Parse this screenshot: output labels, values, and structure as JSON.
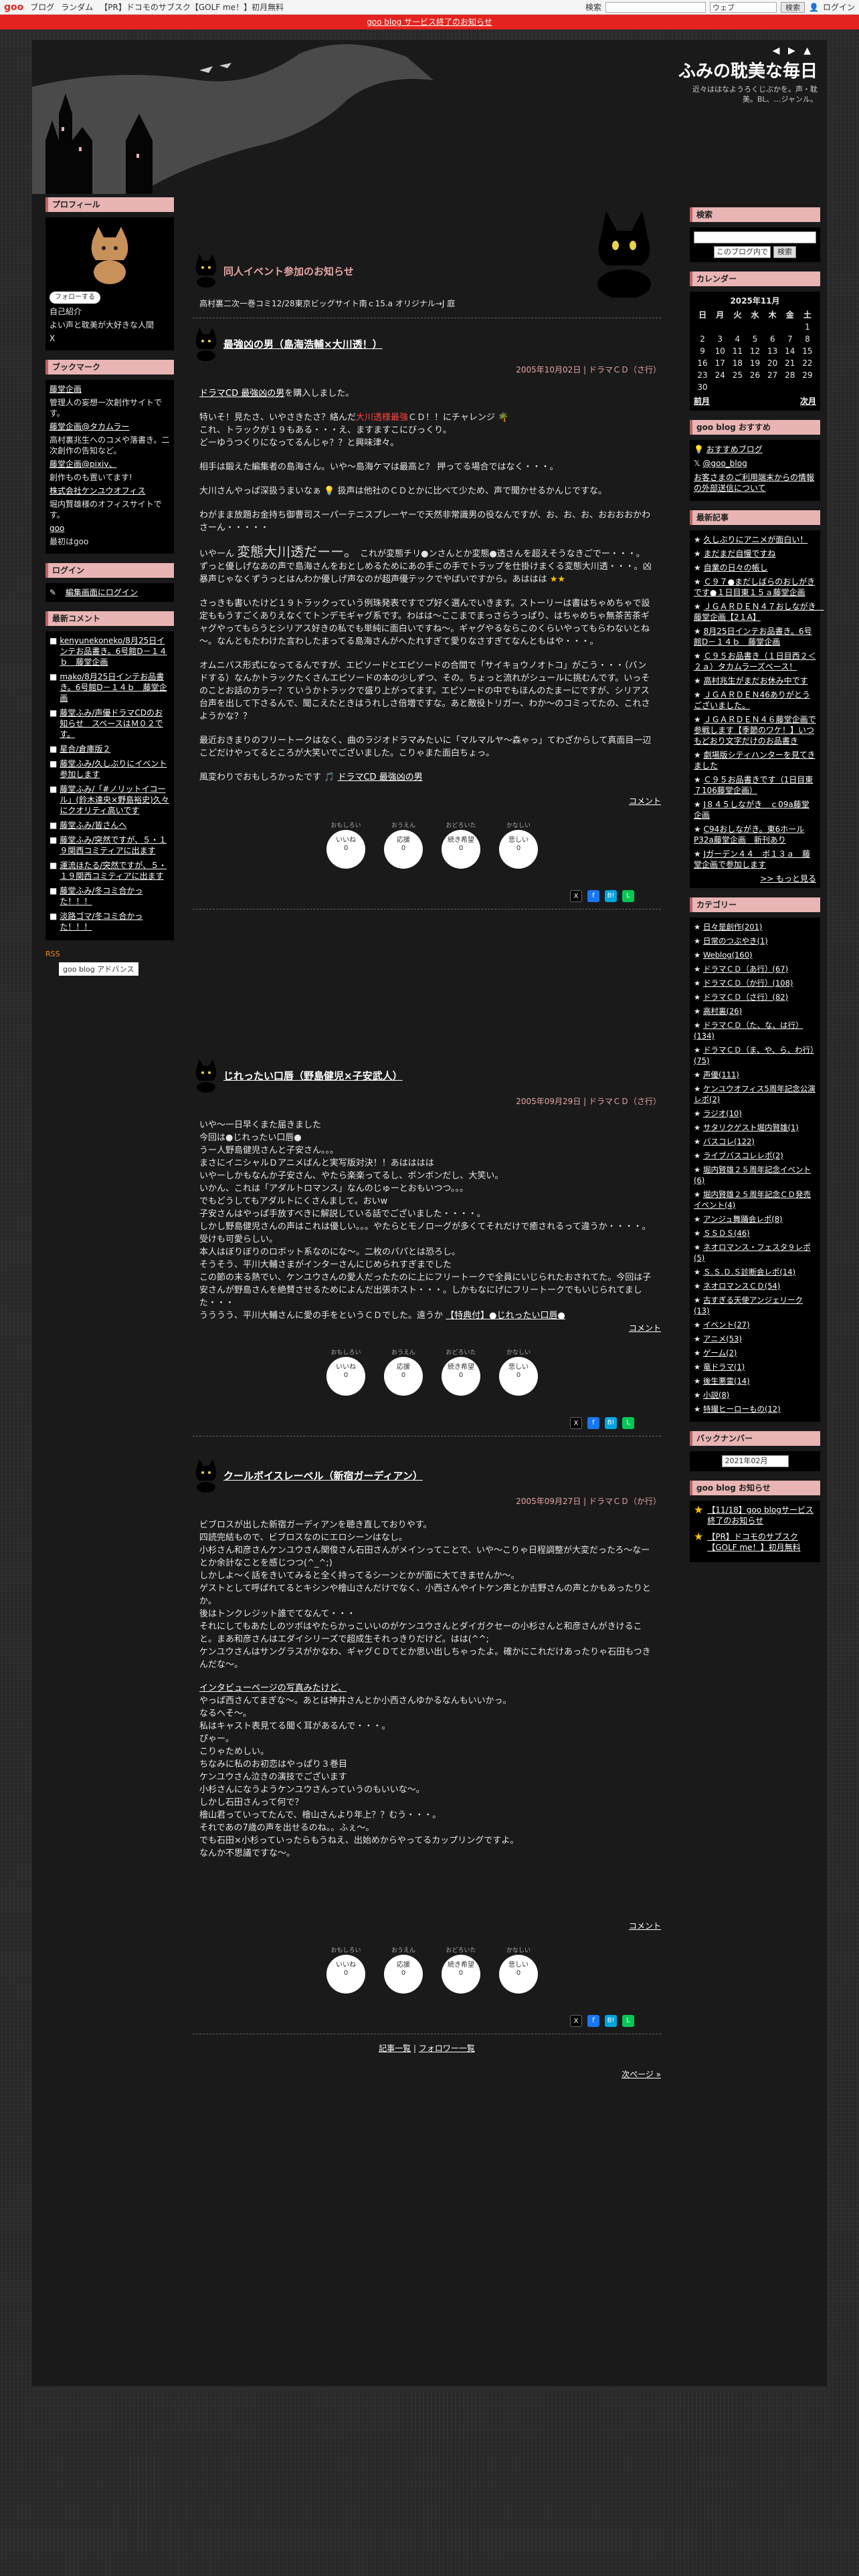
{
  "global_header": {
    "logo": "goo",
    "links": [
      "ブログ",
      "ランダム",
      "【PR】ドコモのサブスク【GOLF me！】初月無料"
    ],
    "search_label": "検索",
    "search_scope": "ウェブ",
    "search_button": "検索",
    "login": "ログイン"
  },
  "notice": {
    "text": "goo blog サービス終了のお知らせ"
  },
  "site": {
    "nav_arrows": "◀ ▶ ▲",
    "title": "ふみの耽美な毎日",
    "description": "近々ははなようろくじぶかを。声・耽美。BL、…ジャンル。"
  },
  "left": {
    "profile_h": "プロフィール",
    "follow": "フォローする",
    "profile_lines": [
      "自己紹介",
      "よい声と耽美が大好きな人間"
    ],
    "x_mark": "X",
    "bookmark_h": "ブックマーク",
    "bookmarks": [
      "藤堂企画",
      "管理人の妄想一次創作サイトです。",
      "藤堂企画@タカムラー",
      "高村裏兆生へのコメや落書き。二次創作の告知など。",
      "藤堂企画@pixiv、",
      "創作ものも置いてます!",
      "株式会社ケンユウオフィス",
      "堀内賢雄様のオフィスサイトです。",
      "goo",
      "最初はgoo"
    ],
    "login_h": "ログイン",
    "login_link": "編集画面にログイン",
    "comments_h": "最新コメント",
    "comments": [
      "kenyunekoneko/8月25日インテお品書き。6号館D－１４ｂ　藤堂企画",
      "mako/8月25日インテお品書き。6号館D－１４ｂ　藤堂企画",
      "藤堂ふみ/声優ドラマCDのお知らせ　スペースはＭ０２です。",
      "星合/倉庫版２",
      "藤堂ふみ/久しぶりにイベント参加します",
      "藤堂ふみ/「#ノリットイコール」(鈴木達央×野島裕史)久々にクオリティ高いです",
      "藤堂ふみ/皆さんへ",
      "藤堂ふみ/突然ですが、５・１９関西コミティアに出ます",
      "運流ほたる/突然ですが、５・１９関西コミティアに出ます",
      "藤堂ふみ/冬コミ合かった！！！",
      "淡路ゴマ/冬コミ合かった！！！"
    ],
    "rss": "RSS",
    "adv": "goo blog アドバンス"
  },
  "right": {
    "search_h": "検索",
    "search_scope": "このブログ内で",
    "search_button": "検索",
    "calendar_h": "カレンダー",
    "calendar_title": "2025年11月",
    "weekdays": [
      "日",
      "月",
      "火",
      "水",
      "木",
      "金",
      "土"
    ],
    "weeks": [
      [
        "",
        "",
        "",
        "",
        "",
        "",
        "1"
      ],
      [
        "2",
        "3",
        "4",
        "5",
        "6",
        "7",
        "8"
      ],
      [
        "9",
        "10",
        "11",
        "12",
        "13",
        "14",
        "15"
      ],
      [
        "16",
        "17",
        "18",
        "19",
        "20",
        "21",
        "22"
      ],
      [
        "23",
        "24",
        "25",
        "26",
        "27",
        "28",
        "29"
      ],
      [
        "30",
        "",
        "",
        "",
        "",
        "",
        ""
      ]
    ],
    "cal_prev": "前月",
    "cal_next": "次月",
    "recommend_h": "goo blog おすすめ",
    "recommend_1": "おすすめブログ",
    "recommend_2": "@goo_blog",
    "recommend_note": "お客さまのご利用端末からの情報の外部送信について",
    "recent_h": "最新記事",
    "recent": [
      "久しぶりにアニメが面白い！",
      "まだまだ自慢ですね",
      "自業の日々の帳し",
      "Ｃ９７●まだしばらのおしがきです●１日目東１５ａ藤堂企画",
      "ＪＧＡＲＤＥＮ４７おしながき　藤堂企画【2１A】",
      "8月25日インテお品書き。6号館D－１４ｂ　藤堂企画",
      "Ｃ９５お品書き（１日目西２＜２ａ）タカムラーズベース！",
      "高村兆生がまだお休み中です",
      "ＪＧＡＲＤＥＮ46ありがとうございました。",
      "ＪＧＡＲＤＥＮ４６藤堂企画で参戦します【季節のワケ！】いつもどおり文字だけのお品書き",
      "劇場版シティハンターを見てきました",
      "Ｃ９５お品書きです（1日目東７106藤堂企画）",
      "J８４５しながき　ｃ09a藤堂企画",
      "C94おしながき。東6ホールP32a藤堂企画　新刊あり",
      "Jガーデン４４　ボ１３ａ　藤堂企画で参加します"
    ],
    "recent_more": ">> もっと見る",
    "category_h": "カテゴリー",
    "categories": [
      "日々是創作(201)",
      "日常のつぶやき(1)",
      "Weblog(160)",
      "ドラマＣＤ（あ行）(67)",
      "ドラマＣＤ（か行）(108)",
      "ドラマＣＤ（さ行）(82)",
      "高村裏(26)",
      "ドラマＣＤ（た、な、は行）(134)",
      "ドラマＣＤ（ま、や、ら、わ行）(75)",
      "声優(111)",
      "ケンユウオフィス5周年記念公演レポ(2)",
      "ラジオ(10)",
      "サタリクゲスト堀内賢雄(1)",
      "バスコレ(122)",
      "ライブバスコレレポ(2)",
      "堀内賢雄２５周年記念イベント(6)",
      "堀内賢雄２５周年記念ＣＤ発売イベント(4)",
      "アンジュ舞踊会レポ(8)",
      "ＳＳＤＳ(46)",
      "ネオロマンス・フェスタ９レポ(5)",
      "Ｓ.Ｓ.Ｄ.Ｓ診断会レポ(14)",
      "ネオロマンスＣＤ(54)",
      "古すぎる天使アンジェリーク(13)",
      "イベント(27)",
      "アニメ(53)",
      "ゲーム(2)",
      "竜ドラマ(1)",
      "後生悪霊(14)",
      "小説(8)",
      "特撮ヒーローもの(12)"
    ],
    "backnumber_h": "バックナンバー",
    "backnumber_value": "2021年02月",
    "notice_h": "goo blog お知らせ",
    "notices": [
      "【11/18】goo blogサービス終了のお知らせ",
      "【PR】ドコモのサブスク【GOLF me！】初月無料"
    ]
  },
  "pinned": {
    "title": "同人イベント参加のお知らせ",
    "sub": "高村裏二次一巻コミ12/28東京ビッグサイト南ｃ15.a オリジナル→J 庭"
  },
  "entries": [
    {
      "title": "最強凶の男（島海浩輔×大川透！）",
      "meta": "2005年10月02日 | ドラマＣＤ（さ行）",
      "lead_link": "ドラマCD 最強凶の男",
      "lead_rest": "を購入しました。",
      "p1a": "特いそ！見たさ、いやさきたさ？絡んだ",
      "p1red": "大川透様最強",
      "p1b": "ＣＤ！！にチャレンジ",
      "p1c": "これ、トラックが１９もある・・・え、ますますこにびっくり。",
      "p1d": "どーゆうつくりになってるんじゃ？？と興味津々。",
      "p2": "相手は鍛えた編集者の島海さん。いや～島海ケマは最高と？ 押ってる場合ではなく・・・。",
      "p3a": "大川さんやっぱ深扱うまいなぁ",
      "p3b": "扱声は他社のＣＤとかに比べて少ため、声で聞かせるかんじですな。",
      "p4": "わがまま放題お金持ち御曹司スーパーテニスプレーヤーで天然非常識男の役なんですが、お、お、お、おおおおかわさーん・・・・・",
      "p5a": "いやーん",
      "p5big": "変態大川透だーー。",
      "p5b": "これが変態チリ●ンさんとか変態●透さんを超えそうなきごでー・・・。",
      "p5c": "ずっと優しげなあの声で島海さんをおとしめるためにあの手この手でトラップを仕掛けまくる変態大川透・・・。凶暴声じゃなくずうっとはんわか優しげ声なのが超声優テックでやばいですから。あははは",
      "p6": "さっきも書いたけど１９トラックっていう例珠発表ですでプ好く選んでいきます。ストーリーは書はちゃめちゃで設定ももうすごくありえなくてトンデモギャグ系です。わはは～ここまでまっさらうっぱり、はちゃめちゃ無茶苦茶ギャグやってもらうとシリアス好きの私でも単純に面白いですね～。ギャグやるならこのくらいやってもらわないとね～。なんともたわけた言わしたまってる島海さんがへたれすぎて愛りなさすぎてなんともはや・・・。",
      "p7": "オムニバス形式になってるんですが、エピソードとエピソードの合間で「サイキョウノオトコ」がこう・・・（バンドする）なんかトラックたくさんエピソードの本の少しずつ、その。ちょっと流れがシュールに挑むんです。いっそのことお話のカラー？ていうかトラックで盛り上がってます。エピソードの中でもほんのたまーにですが、シリアス台声を出して下さるんで、聞こえたときはうれしさ倍増ですな。あと敵役トリガー、わか～のコミってたの、これさようかな？？",
      "p8": "最近おきまりのフリートークはなく、曲のラジオドラマみたいに「マルマルヤ～森ゃっ」てわざからして真面目一辺こどだけやってるところが大笑いでございました。こりゃまた面白ちょっ。",
      "p9a": "風変わりでおもしろかったです",
      "p9b": "ドラマCD 最強凶の男",
      "comment": "コメント",
      "reactions": [
        {
          "top": "おもしろい",
          "label": "いいね",
          "count": "0"
        },
        {
          "top": "おうえん",
          "label": "応援",
          "count": "0"
        },
        {
          "top": "おどろいた",
          "label": "続き希望",
          "count": "0"
        },
        {
          "top": "かなしい",
          "label": "悲しい",
          "count": "0"
        }
      ]
    },
    {
      "title": "じれったい口唇（野島健児×子安武人）",
      "meta": "2005年09月29日 | ドラマＣＤ（さ行）",
      "body": [
        "いや～一日早くまた届きました",
        "今回は●じれったい口唇●",
        "うー人野島健児さんと子安さん。。。",
        "まさにイニシャルＤアニメばんと実写版対決！！あはははは",
        "いやーしかもなんか子安さん、やたら楽楽ってるし、ボンボンだし、大笑い。",
        "いかん、これは「アダルトロマンス」なんのじゅーとおもいつつ。。。",
        "でもどうしてもアダルトにくさんまして。おいw",
        "子安さんはやっぱ手放すべきに解説している話でございました・・・・。",
        "しかし野島健児さんの声はこれは優しい。。。やたらとモノローグが多くてそれだけで癒されるって違うか・・・・。受けも可愛らしい。",
        "本人はぼりぼりのロボット系なのにな～。二枚のパパとは恐ろし。",
        "そうそう、平川大輔さまがインターさんにじめられすぎまでした",
        "この節の末る熱でい、ケンユウさんの愛人だったたのに上にフリートークで全員にいじられたおされてた。今回は子安さんが野島さんを絶賛させるためによんだ出張ホスト・・・。しかもなにげにフリートークでもいじられてました・・・",
        "うううう、平川大輔さんに愛の手をというＣＤでした。遠うか"
      ],
      "tail_link": "【特典付】●じれったい口唇●",
      "comment": "コメント",
      "reactions": [
        {
          "top": "おもしろい",
          "label": "いいね",
          "count": "0"
        },
        {
          "top": "おうえん",
          "label": "応援",
          "count": "0"
        },
        {
          "top": "おどろいた",
          "label": "続き希望",
          "count": "0"
        },
        {
          "top": "かなしい",
          "label": "悲しい",
          "count": "0"
        }
      ]
    },
    {
      "title": "クールボイスレーベル（新宿ガーディアン）",
      "meta": "2005年09月27日 | ドラマＣＤ（か行）",
      "body": [
        "ビブロスが出した新宿ガーディアンを聴き直しておりやす。",
        "四読完結もので、ビブロスなのにエロシーンはなし。",
        "小杉さん和彦さんケンユウさん関俊さん石田さんがメインってことで、いや～こりゃ日程調整が大変だったろ～なーとか余計なことを感じつつ(^_^;)",
        "しかしよ～く話をきいてみると全く持ってるシーンとかが面に大てきませんか～。",
        "ゲストとして呼ばれてるとキシンや檜山さんだけでなく、小西さんやイトケン声とか吉野さんの声とかもあったりとか。",
        "後はトンクレジット誰でてなんて・・・",
        "それにしてもあたしのツボはやたらかっこいいのがケンユウさんとダイガクセーの小杉さんと和彦さんがきけること。まあ和彦さんはエダイシリーズで超成生それっきりだけど。はは(^^;",
        "ケンユウさんはサングラスがかなわ、ギャグＣＤてとか思い出しちゃったよ。確かにこれだけあったりゃ石田もつきんだな～。",
        "インタビューページの写真みたけど、",
        "やっぱ西さんてまぎな～。あとは神井さんとか小西さんゆかるなんもいいかっ。",
        "なるへそ～。",
        "私はキャスト表見てる聞く耳があるんで・・・。",
        "ぴゃー。",
        "こりゃためしい。",
        "ちなみに私のお初恋はやっぱり３巻目",
        "ケンユウさん泣きの演技でございます",
        "小杉さんになうようケンユウさんっていうのもいいな～。",
        "しかし石田さんって何で？",
        "檜山君っていってたんで、檜山さんより年上？？むう・・・。",
        "それであの7歳の声を出せるのね。。ふぇ～。",
        "でも石田×小杉っていったらもうねえ、出始めからやってるカップリングですよ。",
        "なんか不思議ですな～。"
      ],
      "comment": "コメント",
      "reactions": [
        {
          "top": "おもしろい",
          "label": "いいね",
          "count": "0"
        },
        {
          "top": "おうえん",
          "label": "応援",
          "count": "0"
        },
        {
          "top": "おどろいた",
          "label": "続き希望",
          "count": "0"
        },
        {
          "top": "かなしい",
          "label": "悲しい",
          "count": "0"
        }
      ]
    }
  ],
  "footer_nav": {
    "list": "記事一覧",
    "sep": "|",
    "follower": "フォロワー一覧",
    "next": "次ページ »"
  },
  "share": [
    "X",
    "f",
    "B!",
    "L"
  ],
  "colors": {
    "accent_red": "#e4231e",
    "heading_pink": "#e8b4b4",
    "title_pink": "#e6a6a6"
  }
}
